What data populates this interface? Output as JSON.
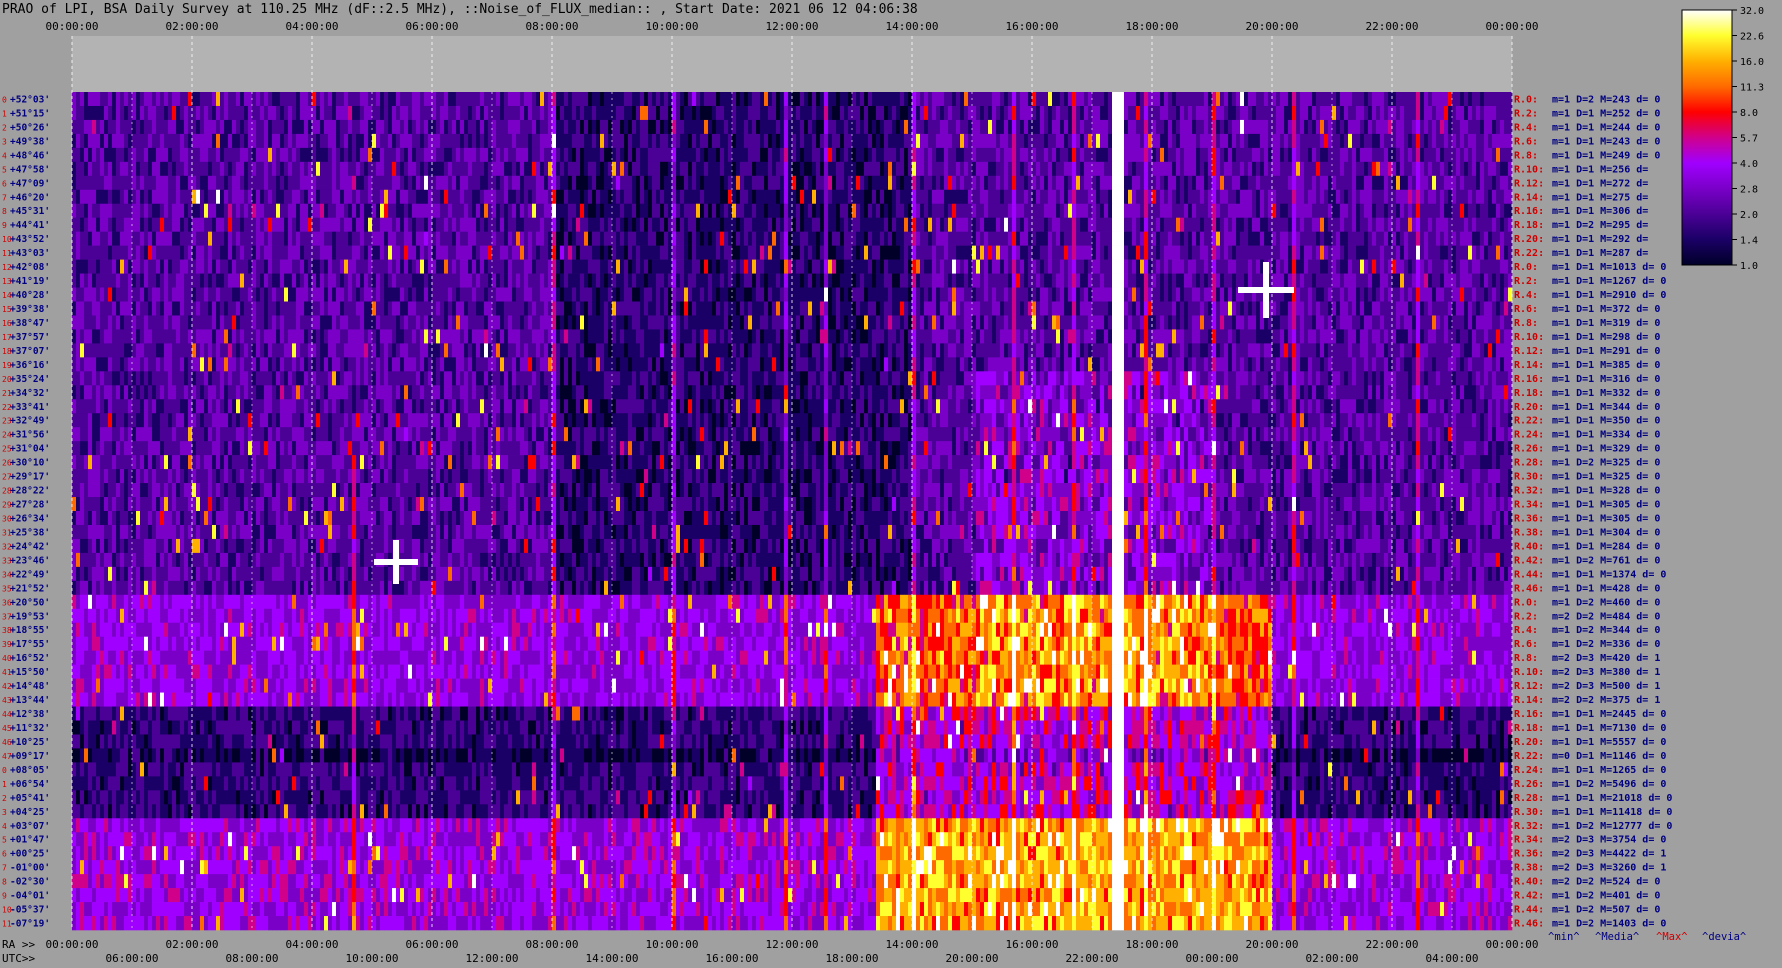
{
  "header": {
    "title": "PRAO of LPI, BSA Daily Survey at 110.25 MHz (dF::2.5 MHz), ::Noise_of_FLUX_median:: , Start Date: 2021 06 12 04:06:38"
  },
  "chart_data": {
    "type": "heatmap",
    "title": "PRAO of LPI, BSA Daily Survey at 110.25 MHz (dF::2.5 MHz), ::Noise_of_FLUX_median:: , Start Date: 2021 06 12 04:06:38",
    "top_ticks": [
      "00:00:00",
      "02:00:00",
      "04:00:00",
      "06:00:00",
      "08:00:00",
      "10:00:00",
      "12:00:00",
      "14:00:00",
      "16:00:00",
      "18:00:00",
      "20:00:00",
      "22:00:00",
      "00:00:00"
    ],
    "ra_prefix": "RA >>",
    "ra_ticks": [
      "00:00:00",
      "02:00:00",
      "04:00:00",
      "06:00:00",
      "08:00:00",
      "10:00:00",
      "12:00:00",
      "14:00:00",
      "16:00:00",
      "18:00:00",
      "20:00:00",
      "22:00:00",
      "00:00:00"
    ],
    "utc_prefix": "UTC>>",
    "utc_ticks": [
      "06:00:00",
      "08:00:00",
      "10:00:00",
      "12:00:00",
      "14:00:00",
      "16:00:00",
      "18:00:00",
      "20:00:00",
      "22:00:00",
      "00:00:00",
      "02:00:00",
      "04:00:00"
    ],
    "dec_labels": [
      "+52°03'",
      "+51°15'",
      "+50°26'",
      "+49°38'",
      "+48°46'",
      "+47°58'",
      "+47°09'",
      "+46°20'",
      "+45°31'",
      "+44°41'",
      "+43°52'",
      "+43°03'",
      "+42°08'",
      "+41°19'",
      "+40°28'",
      "+39°38'",
      "+38°47'",
      "+37°57'",
      "+37°07'",
      "+36°16'",
      "+35°24'",
      "+34°32'",
      "+33°41'",
      "+32°49'",
      "+31°56'",
      "+31°04'",
      "+30°10'",
      "+29°17'",
      "+28°22'",
      "+27°28'",
      "+26°34'",
      "+25°38'",
      "+24°42'",
      "+23°46'",
      "+22°49'",
      "+21°52'",
      "+20°50'",
      "+19°53'",
      "+18°55'",
      "+17°55'",
      "+16°52'",
      "+15°50'",
      "+14°48'",
      "+13°44'",
      "+12°38'",
      "+11°32'",
      "+10°25'",
      "+09°17'",
      "+08°05'",
      "+06°54'",
      "+05°41'",
      "+04°25'",
      "+03°07'",
      "+01°47'",
      "+00°25'",
      "-01°00'",
      "-02°30'",
      "-04°01'",
      "-05°37'",
      "-07°19'"
    ],
    "beam_labels": [
      "R.0:",
      "R.2:",
      "R.4:",
      "R.6:",
      "R.8:",
      "R.10:",
      "R.12:",
      "R.14:",
      "R.16:",
      "R.18:",
      "R.20:",
      "R.22:",
      "R.0:",
      "R.2:",
      "R.4:",
      "R.6:",
      "R.8:",
      "R.10:",
      "R.12:",
      "R.14:",
      "R.16:",
      "R.18:",
      "R.20:",
      "R.22:",
      "R.24:",
      "R.26:",
      "R.28:",
      "R.30:",
      "R.32:",
      "R.34:",
      "R.36:",
      "R.38:",
      "R.40:",
      "R.42:",
      "R.44:",
      "R.46:",
      "R.0:",
      "R.2:",
      "R.4:",
      "R.6:",
      "R.8:",
      "R.10:",
      "R.12:",
      "R.14:",
      "R.16:",
      "R.18:",
      "R.20:",
      "R.22:",
      "R.24:",
      "R.26:",
      "R.28:",
      "R.30:",
      "R.32:",
      "R.34:",
      "R.36:",
      "R.38:",
      "R.40:",
      "R.42:",
      "R.44:",
      "R.46:"
    ],
    "beam_stats": [
      "m=1 D=2 M=243 d= 0",
      "m=1 D=1 M=252 d= 0",
      "m=1 D=1 M=244 d= 0",
      "m=1 D=1 M=243 d= 0",
      "m=1 D=1 M=249 d= 0",
      "m=1 D=1 M=256 d=",
      "m=1 D=1 M=272 d=",
      "m=1 D=1 M=275 d=",
      "m=1 D=1 M=306 d=",
      "m=1 D=2 M=295 d=",
      "m=1 D=1 M=292 d=",
      "m=1 D=1 M=287 d=",
      "m=1 D=1 M=1013 d= 0",
      "m=1 D=1 M=1267 d= 0",
      "m=1 D=1 M=2910 d= 0",
      "m=1 D=1 M=372 d= 0",
      "m=1 D=1 M=319 d= 0",
      "m=1 D=1 M=298 d= 0",
      "m=1 D=1 M=291 d= 0",
      "m=1 D=1 M=385 d= 0",
      "m=1 D=1 M=316 d= 0",
      "m=1 D=1 M=332 d= 0",
      "m=1 D=1 M=344 d= 0",
      "m=1 D=1 M=350 d= 0",
      "m=1 D=1 M=334 d= 0",
      "m=1 D=1 M=329 d= 0",
      "m=1 D=2 M=325 d= 0",
      "m=1 D=1 M=325 d= 0",
      "m=1 D=1 M=328 d= 0",
      "m=1 D=1 M=305 d= 0",
      "m=1 D=1 M=305 d= 0",
      "m=1 D=1 M=304 d= 0",
      "m=1 D=1 M=284 d= 0",
      "m=1 D=2 M=761 d= 0",
      "m=1 D=1 M=1374 d= 0",
      "m=1 D=1 M=428 d= 0",
      "m=1 D=2 M=460 d= 0",
      "m=2 D=2 M=484 d= 0",
      "m=1 D=2 M=344 d= 0",
      "m=1 D=2 M=336 d= 0",
      "m=2 D=3 M=420 d= 1",
      "m=2 D=3 M=380 d= 1",
      "m=2 D=3 M=500 d= 1",
      "m=2 D=2 M=375 d= 1",
      "m=1 D=1 M=2445 d= 0",
      "m=1 D=1 M=7130 d= 0",
      "m=1 D=1 M=5557 d= 0",
      "m=0 D=1 M=1146 d= 0",
      "m=1 D=1 M=1265 d= 0",
      "m=1 D=2 M=5496 d= 0",
      "m=1 D=1 M=21018 d= 0",
      "m=1 D=1 M=11418 d= 0",
      "m=1 D=2 M=12777 d= 0",
      "m=2 D=3 M=3754 d= 0",
      "m=2 D=3 M=4422 d= 1",
      "m=2 D=3 M=3260 d= 1",
      "m=2 D=2 M=524 d= 0",
      "m=1 D=2 M=401 d= 0",
      "m=1 D=2 M=507 d= 0",
      "m=1 D=2 M=1403 d= 0"
    ],
    "colorbar_ticks": [
      "32.0",
      "22.6",
      "16.0",
      "11.3",
      "8.0",
      "5.7",
      "4.0",
      "2.8",
      "2.0",
      "1.4",
      "1.0"
    ],
    "legend": [
      "^min^",
      "^Media^",
      "^Max^",
      "^devia^"
    ],
    "colormap": [
      "#000028",
      "#1a0066",
      "#4b0096",
      "#7a00c8",
      "#a000ff",
      "#d0008a",
      "#ff0000",
      "#ff6a00",
      "#ffb000",
      "#ffff30",
      "#ffffff"
    ],
    "grid": true
  }
}
